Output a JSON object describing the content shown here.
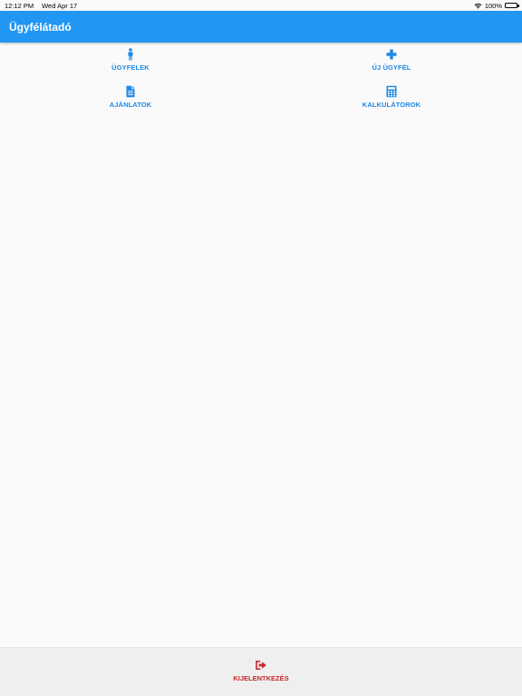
{
  "status_bar": {
    "time": "12:12 PM",
    "date": "Wed Apr 17",
    "battery": "100%",
    "wifi_icon": "wifi-icon",
    "battery_icon": "battery-icon"
  },
  "app_bar": {
    "title": "Ügyfélátadó",
    "color": "#2196f3"
  },
  "menu": {
    "clients": {
      "label": "ÜGYFELEK",
      "icon": "person-icon"
    },
    "new_client": {
      "label": "ÚJ ÜGYFÉL",
      "icon": "plus-icon"
    },
    "offers": {
      "label": "AJÁNLATOK",
      "icon": "document-icon"
    },
    "calculators": {
      "label": "KALKULÁTOROK",
      "icon": "calculator-icon"
    },
    "accent_color": "#1e88e5"
  },
  "footer": {
    "logout": {
      "label": "KIJELENTKEZÉS",
      "icon": "logout-icon"
    },
    "logout_color": "#c62828"
  }
}
